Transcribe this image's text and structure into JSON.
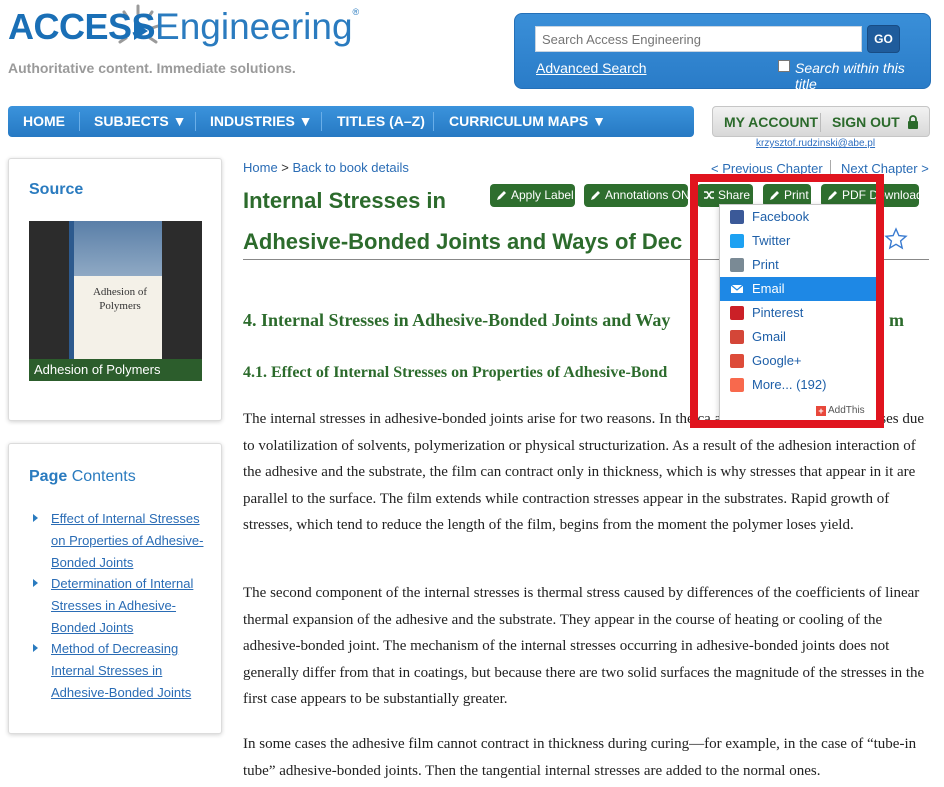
{
  "logo": {
    "access": "ACCESS",
    "engineering": "Engineering",
    "registered": "®",
    "tagline": "Authoritative content. Immediate solutions."
  },
  "search": {
    "placeholder": "Search Access Engineering",
    "go_label": "GO",
    "advanced_label": "Advanced Search",
    "within_title_label": "Search within this title"
  },
  "nav": {
    "items": [
      "HOME",
      "SUBJECTS ▼",
      "INDUSTRIES ▼",
      "TITLES (A–Z)",
      "CURRICULUM MAPS ▼"
    ]
  },
  "account": {
    "my_account": "MY ACCOUNT",
    "sign_out": "SIGN OUT",
    "email": "krzysztof.rudzinski@abe.pl"
  },
  "sidebar": {
    "source_title": "Source",
    "book_cover_title": "Adhesion of Polymers",
    "book_caption": "Adhesion of Polymers",
    "contents_title_bold": "Page",
    "contents_title_rest": " Contents",
    "toc": [
      "Effect of Internal Stresses on Properties of Adhesive-Bonded Joints",
      "Determination of Internal Stresses in Adhesive-Bonded Joints",
      "Method of Decreasing Internal Stresses in Adhesive-Bonded Joints"
    ]
  },
  "main": {
    "breadcrumb_home": "Home",
    "breadcrumb_sep": " > ",
    "breadcrumb_back": "Back to book details",
    "prev_chapter": "< Previous Chapter",
    "next_chapter": "Next Chapter >",
    "title_line1": "Internal Stresses in",
    "title_line2": "Adhesive-Bonded Joints and Ways of Dec",
    "buttons": {
      "apply_label": "Apply Label",
      "annotations": "Annotations ON",
      "share": "Share",
      "print": "Print",
      "pdf": "PDF Download"
    },
    "h2": "4. Internal Stresses in Adhesive-Bonded Joints and Way",
    "h2_tail": "m",
    "h3": "4.1. Effect of Internal Stresses on Properties of Adhesive-Bond",
    "paragraphs": [
      "The internal stresses in adhesive-bonded joints arise for two reasons. In the ca adhesive, its volume decreases due to volatilization of solvents, polymerization or physical structurization. As a result of the adhesion interaction of the adhesive and the substrate, the film can contract only in thickness, which is why stresses that appear in it are parallel to the surface. The film extends while contraction stresses appear in the substrates. Rapid growth of stresses, which tend to reduce the length of the film, begins from the moment the polymer loses yield.",
      "The second component of the internal stresses is thermal stress caused by differences of the coefficients of linear thermal expansion of the adhesive and the substrate. They appear in the course of heating or cooling of the adhesive-bonded joint. The mechanism of the internal stresses occurring in adhesive-bonded joints does not generally differ from that in coatings, but because there are two solid surfaces the magnitude of the stresses in the first case appears to be substantially greater.",
      "In some cases the adhesive film cannot contract in thickness during curing—for example, in the case of “tube-in tube” adhesive-bonded joints. Then the tangential internal stresses are added to the normal ones."
    ]
  },
  "share_menu": {
    "items": [
      {
        "label": "Facebook",
        "icon": "facebook-icon",
        "color": "#3b5998"
      },
      {
        "label": "Twitter",
        "icon": "twitter-icon",
        "color": "#1da1f2"
      },
      {
        "label": "Print",
        "icon": "print-icon",
        "color": "#7a8a95"
      },
      {
        "label": "Email",
        "icon": "email-icon",
        "color": "#848484"
      },
      {
        "label": "Pinterest",
        "icon": "pinterest-icon",
        "color": "#cb2027"
      },
      {
        "label": "Gmail",
        "icon": "gmail-icon",
        "color": "#d44638"
      },
      {
        "label": "Google+",
        "icon": "googleplus-icon",
        "color": "#dd4b39"
      },
      {
        "label": "More... (192)",
        "icon": "more-icon",
        "color": "#f8694d"
      }
    ],
    "active_index": 3,
    "addthis": "AddThis"
  },
  "colors": {
    "brand_blue": "#2a7bbf",
    "heading_green": "#2c6b2c",
    "highlight_red": "#e0141e",
    "active_blue": "#1e88e5"
  }
}
